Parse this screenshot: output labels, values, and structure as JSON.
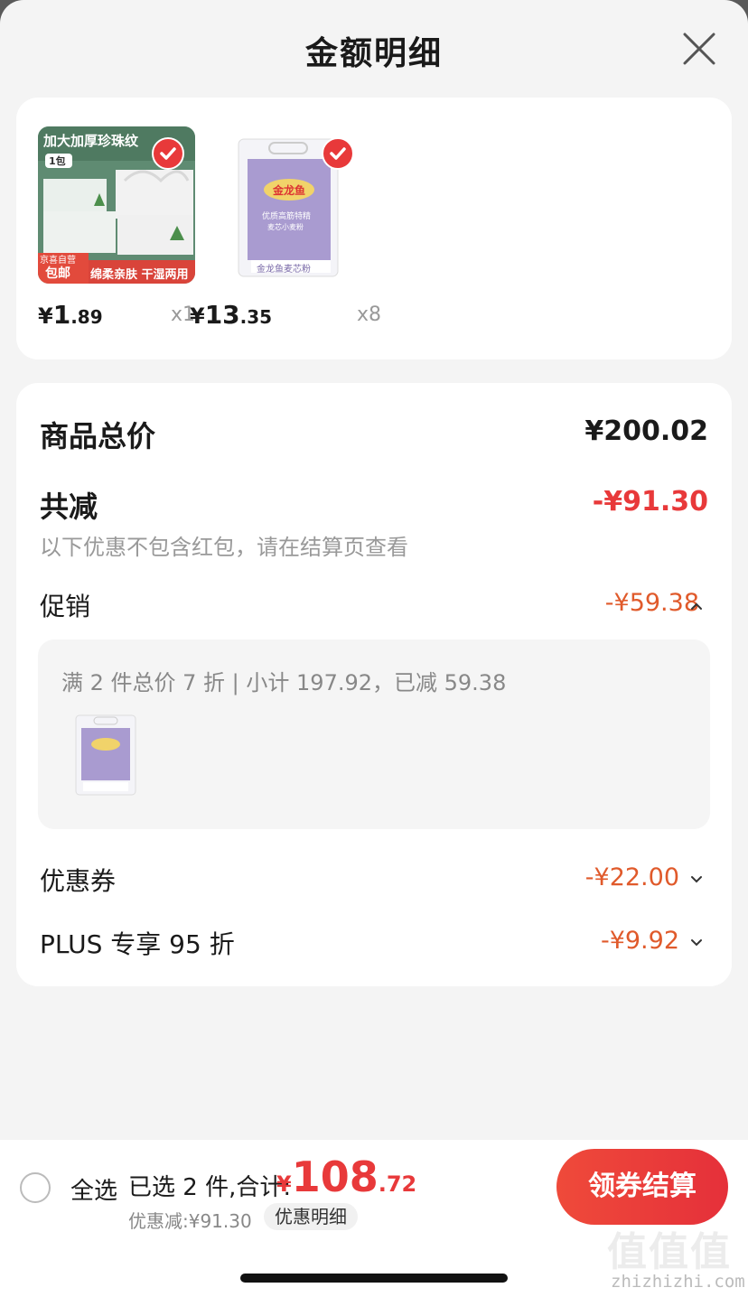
{
  "header": {
    "title": "金额明细"
  },
  "products": [
    {
      "image_overlay_title": "加大加厚珍珠纹",
      "image_overlay_tag": "1包",
      "image_overlay_bottom_left": "京喜自营",
      "image_overlay_bottom_left2": "包邮",
      "image_overlay_bottom_right": "绵柔亲肤 干湿两用",
      "price_yen": "¥",
      "price_int": "1",
      "price_dec": ".89",
      "qty": "x1",
      "checked": true
    },
    {
      "image_overlay_brand": "金龙鱼",
      "image_overlay_title": "优质高筋特精",
      "image_overlay_sub": "麦芯小麦粉",
      "image_overlay_bottom": "金龙鱼麦芯粉",
      "price_yen": "¥",
      "price_int": "13",
      "price_dec": ".35",
      "qty": "x8",
      "checked": true
    }
  ],
  "summary": {
    "total_label": "商品总价",
    "total_value": "¥200.02",
    "reduce_label": "共减",
    "reduce_value": "-¥91.30",
    "reduce_note": "以下优惠不包含红包，请在结算页查看",
    "promo_label": "促销",
    "promo_value": "-¥59.38",
    "promo_detail": "满 2 件总价 7 折 | 小计 197.92，已减 59.38",
    "coupon_label": "优惠券",
    "coupon_value": "-¥22.00",
    "plus_label": "PLUS 专享 95 折",
    "plus_value": "-¥9.92"
  },
  "bottom": {
    "select_all": "全选",
    "selected_text": "已选 2 件,合计:",
    "total_yen": "¥",
    "total_int": "108",
    "total_dec": ".72",
    "discount_text": "优惠减:¥91.30",
    "detail_chip": "优惠明细",
    "checkout": "领券结算"
  },
  "watermark": {
    "site": "zhizhizhi.com",
    "glyphs": "值值值"
  },
  "colors": {
    "accent": "#e8393a",
    "discount": "#e05a2b",
    "bg": "#f4f4f4"
  }
}
